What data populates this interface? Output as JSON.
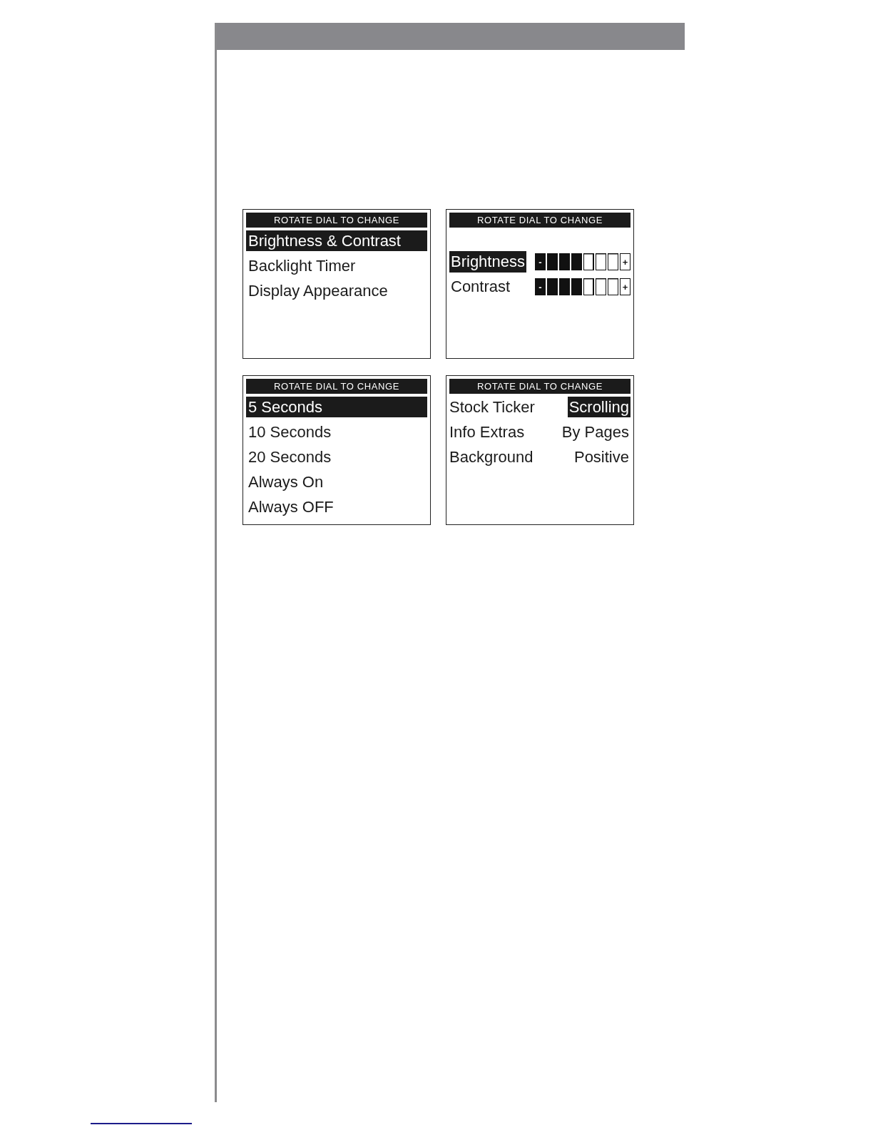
{
  "screens": [
    {
      "kind": "menu",
      "header": "ROTATE DIAL TO CHANGE",
      "items": [
        {
          "label": "Brightness & Contrast",
          "selected": true
        },
        {
          "label": "Backlight Timer",
          "selected": false
        },
        {
          "label": "Display Appearance",
          "selected": false
        }
      ]
    },
    {
      "kind": "levels",
      "header": "ROTATE DIAL TO CHANGE",
      "rows": [
        {
          "label": "Brightness",
          "selected": true,
          "minus": "-",
          "level": 0.5,
          "plus": "+"
        },
        {
          "label": "Contrast",
          "selected": false,
          "minus": "-",
          "level": 0.5,
          "plus": "+"
        }
      ]
    },
    {
      "kind": "menu",
      "header": "ROTATE DIAL TO CHANGE",
      "items": [
        {
          "label": "5 Seconds",
          "selected": true
        },
        {
          "label": "10 Seconds",
          "selected": false
        },
        {
          "label": "20 Seconds",
          "selected": false
        },
        {
          "label": "Always On",
          "selected": false
        },
        {
          "label": "Always OFF",
          "selected": false
        }
      ]
    },
    {
      "kind": "options",
      "header": "ROTATE DIAL TO CHANGE",
      "rows": [
        {
          "label": "Stock Ticker",
          "value": "Scrolling",
          "selected": true
        },
        {
          "label": "Info Extras",
          "value": "By Pages",
          "selected": false
        },
        {
          "label": "Background",
          "value": "Positive",
          "selected": false
        }
      ]
    }
  ]
}
